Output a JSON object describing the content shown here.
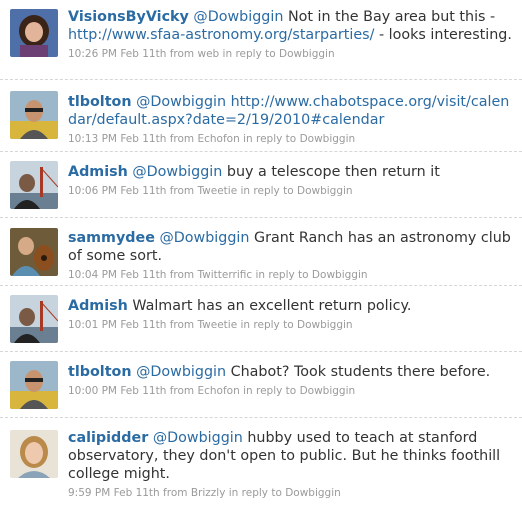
{
  "tweets": [
    {
      "user": "VisionsByVicky",
      "mention": "@Dowbiggin",
      "text_before": "Not in the Bay area but this - ",
      "link": "http://www.sfaa-astronomy.org/starparties/",
      "text_after": " - looks interesting.",
      "meta": "10:26 PM Feb 11th from web in reply to Dowbiggin",
      "avatar": "woman-dark-hair-avatar"
    },
    {
      "user": "tlbolton",
      "mention": "@Dowbiggin",
      "text_before": "",
      "link": "http://www.chabotspace.org/visit/calendar/default.aspx?date=2/19/2010#calendar",
      "text_after": "",
      "meta": "10:13 PM Feb 11th from Echofon in reply to Dowbiggin",
      "avatar": "man-sunglasses-avatar"
    },
    {
      "user": "Admish",
      "mention": "@Dowbiggin",
      "text_before": "buy a telescope then return it",
      "link": "",
      "text_after": "",
      "meta": "10:06 PM Feb 11th from Tweetie in reply to Dowbiggin",
      "avatar": "golden-gate-avatar"
    },
    {
      "user": "sammydee",
      "mention": "@Dowbiggin",
      "text_before": "Grant Ranch has an astronomy club of some sort.",
      "link": "",
      "text_after": "",
      "meta": "10:04 PM Feb 11th from Twitterrific in reply to Dowbiggin",
      "avatar": "man-guitar-avatar"
    },
    {
      "user": "Admish",
      "mention": "",
      "text_before": "Walmart has an excellent return policy.",
      "link": "",
      "text_after": "",
      "meta": "10:01 PM Feb 11th from Tweetie in reply to Dowbiggin",
      "avatar": "golden-gate-avatar"
    },
    {
      "user": "tlbolton",
      "mention": "@Dowbiggin",
      "text_before": "Chabot? Took students there before.",
      "link": "",
      "text_after": "",
      "meta": "10:00 PM Feb 11th from Echofon in reply to Dowbiggin",
      "avatar": "man-sunglasses-avatar"
    },
    {
      "user": "calipidder",
      "mention": "@Dowbiggin",
      "text_before": "hubby used to teach at stanford observatory, they don't open to public. But he thinks foothill college might.",
      "link": "",
      "text_after": "",
      "meta": "9:59 PM Feb 11th from Brizzly in reply to Dowbiggin",
      "avatar": "woman-blonde-avatar"
    }
  ]
}
